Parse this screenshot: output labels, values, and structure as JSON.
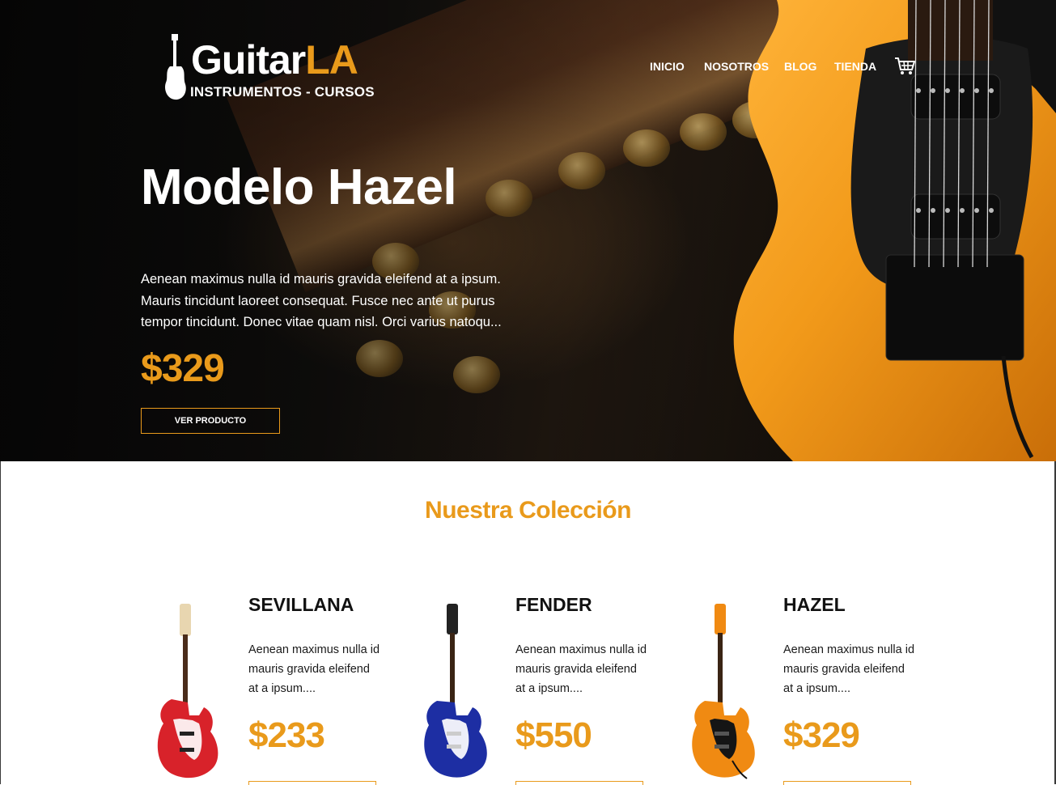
{
  "header": {
    "logo_title_main": "Guitar",
    "logo_title_accent": "LA",
    "logo_subtitle": "INSTRUMENTOS - CURSOS",
    "nav": [
      {
        "label": "INICIO"
      },
      {
        "label": "NOSOTROS"
      },
      {
        "label": "BLOG"
      },
      {
        "label": "TIENDA"
      }
    ],
    "cart_icon": "shopping-cart-icon"
  },
  "hero": {
    "title": "Modelo Hazel",
    "description": "Aenean maximus nulla id mauris gravida eleifend at a ipsum. Mauris tincidunt laoreet consequat. Fusce nec ante ut purus tempor tincidunt. Donec vitae quam nisl. Orci varius natoqu...",
    "price": "$329",
    "button_label": "VER PRODUCTO"
  },
  "collection": {
    "title": "Nuestra Colección",
    "products": [
      {
        "name": "SEVILLANA",
        "description": "Aenean maximus nulla id mauris gravida eleifend at a ipsum....",
        "price": "$233",
        "color": "#d8222a"
      },
      {
        "name": "FENDER",
        "description": "Aenean maximus nulla id mauris gravida eleifend at a ipsum....",
        "price": "$550",
        "color": "#1d2ea3"
      },
      {
        "name": "HAZEL",
        "description": "Aenean maximus nulla id mauris gravida eleifend at a ipsum....",
        "price": "$329",
        "color": "#f08a12"
      }
    ]
  },
  "colors": {
    "accent": "#e99a1b",
    "hero_dark": "#0b0b0b",
    "text_dark": "#111111"
  }
}
